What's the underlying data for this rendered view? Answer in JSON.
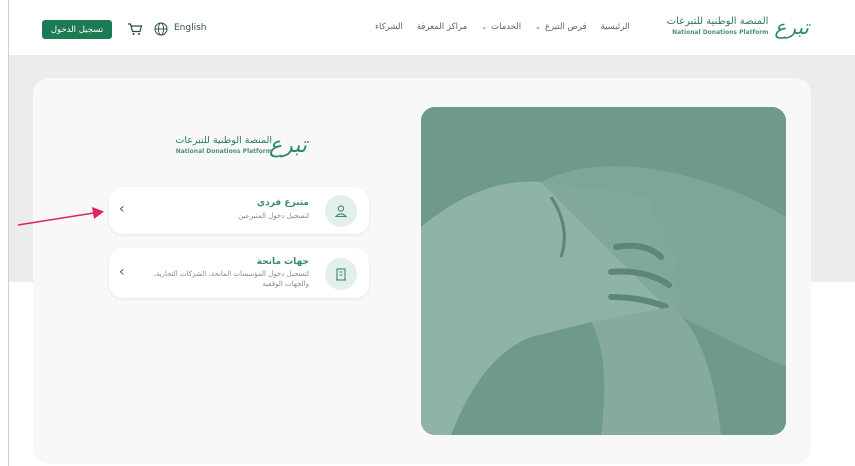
{
  "header": {
    "logo_ar": "المنصة الوطنية للتبرعات",
    "logo_en": "National Donations Platform",
    "logo_mark": "تبرع",
    "nav": [
      {
        "label": "الرئيسية",
        "has_dropdown": false
      },
      {
        "label": "فرص التبرع",
        "has_dropdown": true
      },
      {
        "label": "الخدمات",
        "has_dropdown": true
      },
      {
        "label": "مراكز المعرفة",
        "has_dropdown": false
      },
      {
        "label": "الشركاء",
        "has_dropdown": false
      }
    ],
    "language": "English",
    "login_label": "تسجيل الدخول",
    "icons": [
      "cart-icon",
      "globe-icon"
    ]
  },
  "card": {
    "logo_ar": "المنصة الوطنية للتبرعات",
    "logo_en": "National Donations Platform",
    "logo_mark": "تبرع",
    "options": [
      {
        "title": "متبرع فردي",
        "subtitle": "لتسجيل دخول المتبرعين",
        "icon": "user-icon"
      },
      {
        "title": "جهات مانحة",
        "subtitle": "لتسجيل دخول المؤسسات المانحة، الشركات التجارية، والجهات الوقفية",
        "icon": "building-icon"
      }
    ]
  },
  "colors": {
    "brand_green": "#1c7a55",
    "title_green": "#3d8a6d",
    "annotation_arrow": "#e0245e"
  }
}
